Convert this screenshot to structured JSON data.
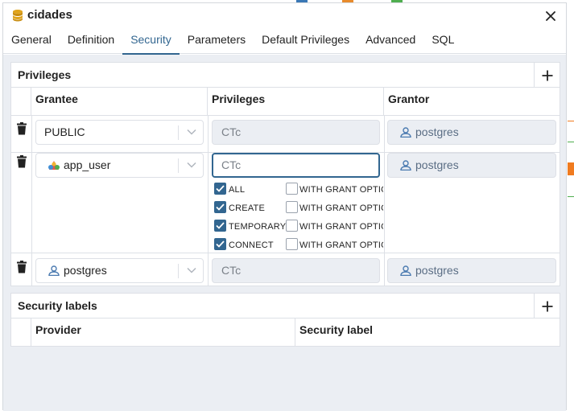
{
  "window": {
    "title": "cidades",
    "close_label": "×"
  },
  "tabs": [
    {
      "label": "General"
    },
    {
      "label": "Definition"
    },
    {
      "label": "Security",
      "active": true
    },
    {
      "label": "Parameters"
    },
    {
      "label": "Default Privileges"
    },
    {
      "label": "Advanced"
    },
    {
      "label": "SQL"
    }
  ],
  "privileges": {
    "title": "Privileges",
    "columns": {
      "grantee": "Grantee",
      "privileges": "Privileges",
      "grantor": "Grantor"
    },
    "rows": [
      {
        "grantee": "PUBLIC",
        "grantee_icon": "none",
        "privileges": "CTc",
        "grantor": "postgres"
      },
      {
        "grantee": "app_user",
        "grantee_icon": "group-icon",
        "privileges": "CTc",
        "grantor": "postgres",
        "options": [
          {
            "label": "ALL",
            "checked": true,
            "grant_label": "WITH GRANT OPTION",
            "grant_checked": false
          },
          {
            "label": "CREATE",
            "checked": true,
            "grant_label": "WITH GRANT OPTION",
            "grant_checked": false
          },
          {
            "label": "TEMPORARY",
            "checked": true,
            "grant_label": "WITH GRANT OPTION",
            "grant_checked": false
          },
          {
            "label": "CONNECT",
            "checked": true,
            "grant_label": "WITH GRANT OPTION",
            "grant_checked": false
          }
        ]
      },
      {
        "grantee": "postgres",
        "grantee_icon": "user-icon",
        "privileges": "CTc",
        "grantor": "postgres"
      }
    ]
  },
  "security_labels": {
    "title": "Security labels",
    "columns": {
      "provider": "Provider",
      "label": "Security label"
    }
  },
  "colors": {
    "accent": "#326690",
    "panel_bg": "#ebeef3",
    "border": "#dde0e6"
  }
}
